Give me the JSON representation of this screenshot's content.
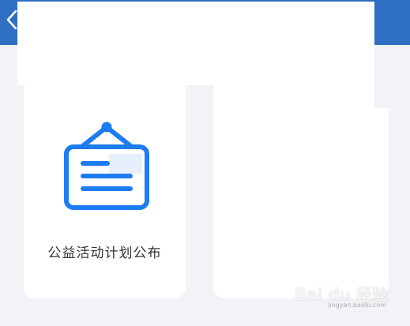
{
  "header": {
    "background_color": "#2f6fc1",
    "back_icon": "chevron-left-icon"
  },
  "cards": [
    {
      "label": "公益活动计划公布",
      "icon": "notice-board-icon",
      "icon_color": "#1e7cf2"
    },
    {
      "label": ""
    }
  ],
  "watermark": {
    "brand": "Bai du 经验",
    "sub": "jingyan.baidu.com"
  }
}
